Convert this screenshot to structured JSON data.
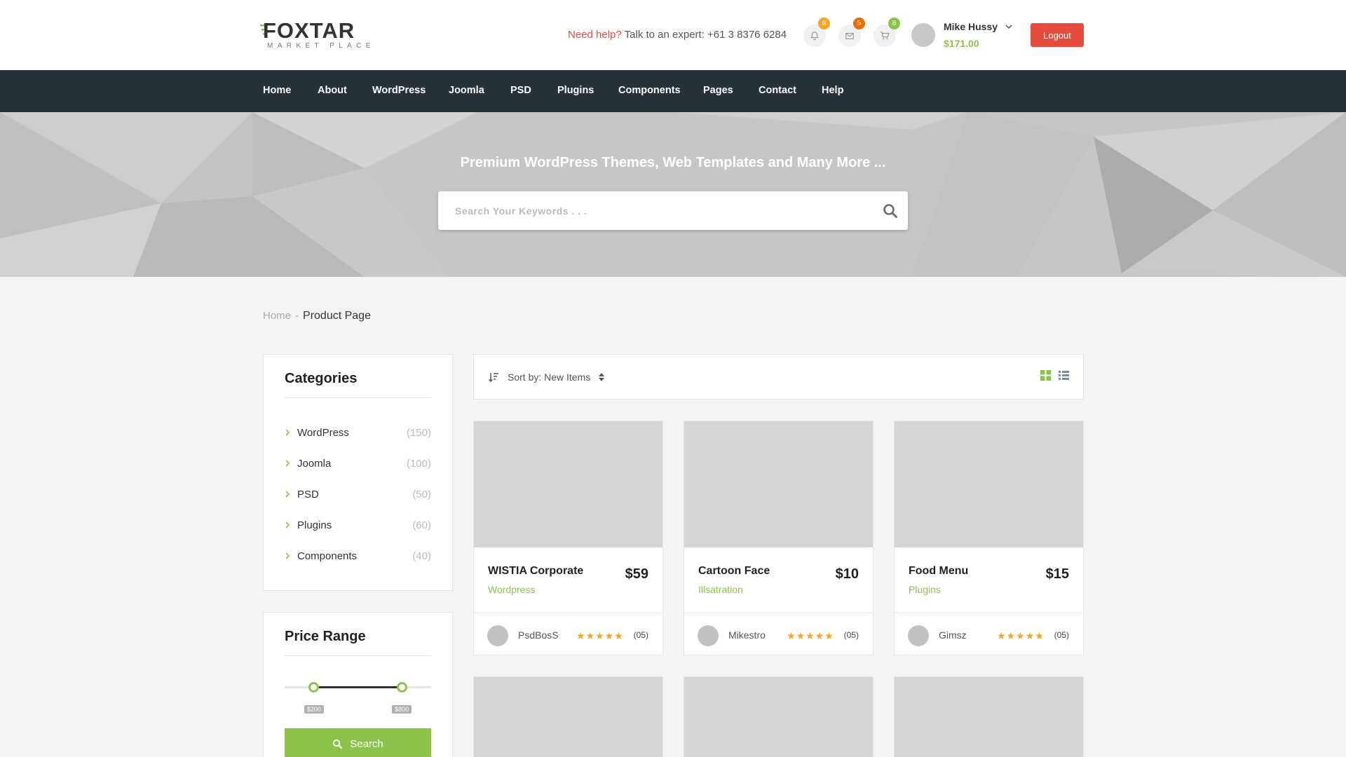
{
  "brand": {
    "name": "FOXTAR",
    "tagline": "MARKET PLACE",
    "accent": "#8bc34a"
  },
  "header": {
    "help_prefix": "Need help?",
    "help_text": "Talk to an expert: +61 3 8376 6284",
    "notifications": {
      "icon": "bell-icon",
      "count": "8"
    },
    "messages": {
      "icon": "envelope-icon",
      "count": "5"
    },
    "cart": {
      "icon": "cart-icon",
      "count": "8"
    },
    "user": {
      "name": "Mike Hussy",
      "balance": "$171.00"
    },
    "logout_label": "Logout"
  },
  "nav": {
    "items": [
      {
        "label": "Home"
      },
      {
        "label": "About"
      },
      {
        "label": "WordPress"
      },
      {
        "label": "Joomla"
      },
      {
        "label": "PSD"
      },
      {
        "label": "Plugins"
      },
      {
        "label": "Components"
      },
      {
        "label": "Pages"
      },
      {
        "label": "Contact"
      },
      {
        "label": "Help"
      }
    ]
  },
  "hero": {
    "title": "Premium WordPress Themes, Web Templates and Many More ...",
    "search_placeholder": "Search Your Keywords . . ."
  },
  "breadcrumb": {
    "home": "Home",
    "separator": "-",
    "current": "Product Page"
  },
  "sidebar": {
    "categories": {
      "title": "Categories",
      "items": [
        {
          "name": "WordPress",
          "count": "(150)"
        },
        {
          "name": "Joomla",
          "count": "(100)"
        },
        {
          "name": "PSD",
          "count": "(50)"
        },
        {
          "name": "Plugins",
          "count": "(60)"
        },
        {
          "name": "Components",
          "count": "(40)"
        }
      ]
    },
    "price_range": {
      "title": "Price Range",
      "min_label": "$200",
      "max_label": "$800",
      "min_fraction": 0.2,
      "max_fraction": 0.8,
      "search_label": "Search"
    }
  },
  "toolbar": {
    "sort_label": "Sort by: New Items",
    "view_mode": "grid"
  },
  "products": [
    {
      "title": "WISTIA Corporate",
      "price": "$59",
      "category": "Wordpress",
      "author": "PsdBosS",
      "stars": 5,
      "rating": "(05)"
    },
    {
      "title": "Cartoon Face",
      "price": "$10",
      "category": "Illsatration",
      "author": "Mikestro",
      "stars": 5,
      "rating": "(05)"
    },
    {
      "title": "Food Menu",
      "price": "$15",
      "category": "Plugins",
      "author": "Gimsz",
      "stars": 5,
      "rating": "(05)"
    }
  ]
}
